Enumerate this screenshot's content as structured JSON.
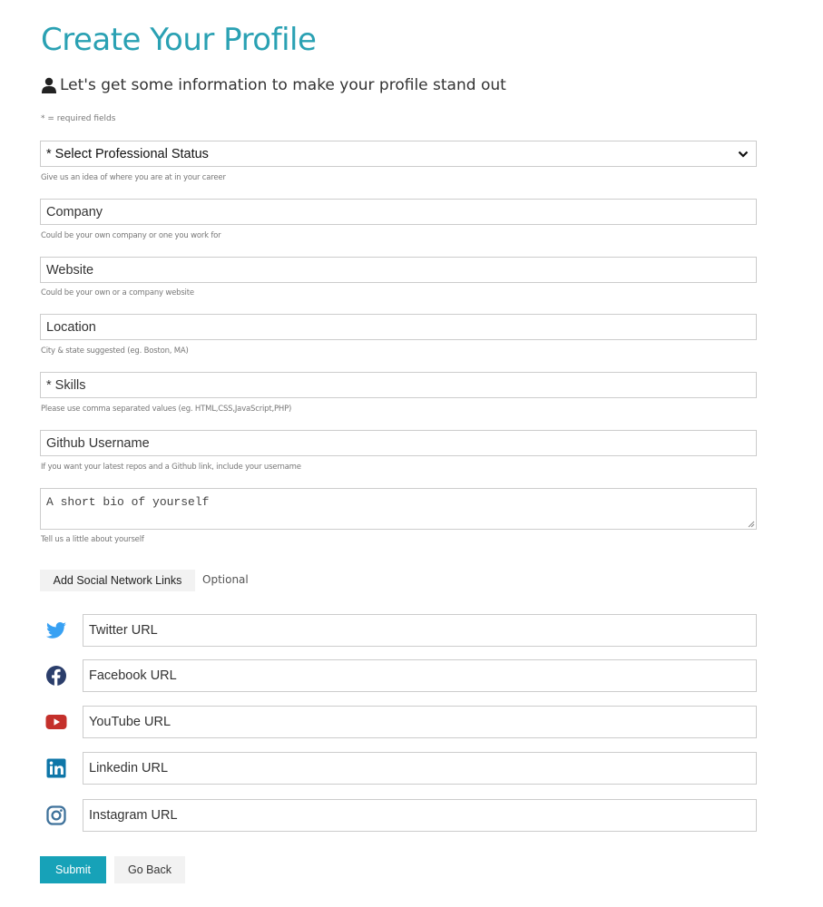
{
  "page": {
    "title": "Create Your Profile",
    "lead": "Let's get some information to make your profile stand out",
    "required_note": "* = required fields"
  },
  "form": {
    "status": {
      "selected": "* Select Professional Status",
      "help": "Give us an idea of where you are at in your career"
    },
    "company": {
      "placeholder": "Company",
      "help": "Could be your own company or one you work for"
    },
    "website": {
      "placeholder": "Website",
      "help": "Could be your own or a company website"
    },
    "location": {
      "placeholder": "Location",
      "help": "City & state suggested (eg. Boston, MA)"
    },
    "skills": {
      "placeholder": "* Skills",
      "help": "Please use comma separated values (eg. HTML,CSS,JavaScript,PHP)"
    },
    "github": {
      "placeholder": "Github Username",
      "help": "If you want your latest repos and a Github link, include your username"
    },
    "bio": {
      "placeholder": "A short bio of yourself",
      "help": "Tell us a little about yourself"
    }
  },
  "social": {
    "toggle_label": "Add Social Network Links",
    "optional_label": "Optional",
    "links": [
      {
        "icon": "twitter-icon",
        "placeholder": "Twitter URL",
        "color": "#38a1f3"
      },
      {
        "icon": "facebook-icon",
        "placeholder": "Facebook URL",
        "color": "#2b3e6b"
      },
      {
        "icon": "youtube-icon",
        "placeholder": "YouTube URL",
        "color": "#c4302b"
      },
      {
        "icon": "linkedin-icon",
        "placeholder": "Linkedin URL",
        "color": "#0e76a8"
      },
      {
        "icon": "instagram-icon",
        "placeholder": "Instagram URL",
        "color": "#3f729b"
      }
    ]
  },
  "actions": {
    "submit_label": "Submit",
    "back_label": "Go Back"
  },
  "colors": {
    "accent": "#17a2b8",
    "title": "#2aa1b3"
  }
}
